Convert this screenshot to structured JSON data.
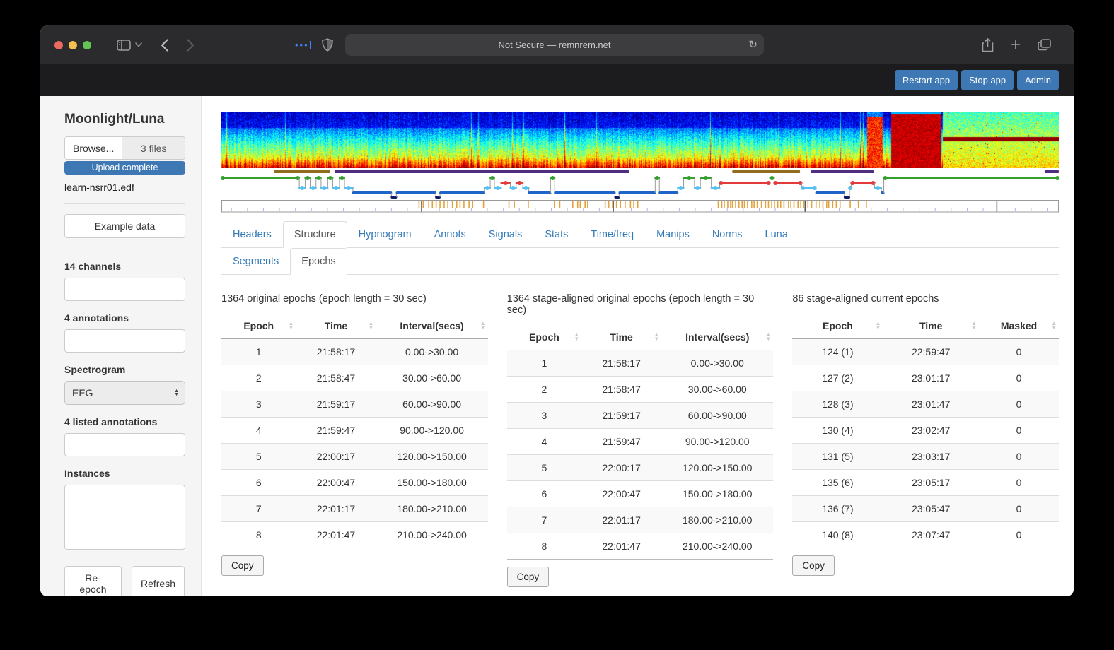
{
  "browser": {
    "url": "Not Secure — remnrem.net"
  },
  "app_header": {
    "buttons": [
      "Restart app",
      "Stop app",
      "Admin"
    ],
    "accent_color": "#3e78b4"
  },
  "sidebar": {
    "title": "Moonlight/Luna",
    "browse_button": "Browse...",
    "file_count": "3 files",
    "upload_status": "Upload complete",
    "file_name": "learn-nsrr01.edf",
    "example_data_button": "Example data",
    "channels_label": "14 channels",
    "channels_value": "",
    "annotations_label": "4 annotations",
    "annotations_value": "",
    "spectrogram_label": "Spectrogram",
    "spectrogram_channel": "EEG",
    "listed_annotations_label": "4 listed annotations",
    "listed_annotations_value": "",
    "instances_label": "Instances",
    "instances_value": "",
    "reepoch_button": "Re-epoch",
    "refresh_button": "Refresh"
  },
  "tabs": {
    "main": [
      "Headers",
      "Structure",
      "Hypnogram",
      "Annots",
      "Signals",
      "Stats",
      "Time/freq",
      "Manips",
      "Norms",
      "Luna"
    ],
    "active_main": "Structure",
    "sub": [
      "Segments",
      "Epochs"
    ],
    "active_sub": "Epochs"
  },
  "tables": [
    {
      "caption": "1364 original epochs (epoch length = 30 sec)",
      "columns": [
        "Epoch",
        "Time",
        "Interval(secs)"
      ],
      "col_widths": [
        "28%",
        "30%",
        "42%"
      ],
      "rows": [
        [
          "1",
          "21:58:17",
          "0.00->30.00"
        ],
        [
          "2",
          "21:58:47",
          "30.00->60.00"
        ],
        [
          "3",
          "21:59:17",
          "60.00->90.00"
        ],
        [
          "4",
          "21:59:47",
          "90.00->120.00"
        ],
        [
          "5",
          "22:00:17",
          "120.00->150.00"
        ],
        [
          "6",
          "22:00:47",
          "150.00->180.00"
        ],
        [
          "7",
          "22:01:17",
          "180.00->210.00"
        ],
        [
          "8",
          "22:01:47",
          "210.00->240.00"
        ]
      ],
      "copy_label": "Copy"
    },
    {
      "caption": "1364 stage-aligned original epochs (epoch length = 30 sec)",
      "columns": [
        "Epoch",
        "Time",
        "Interval(secs)"
      ],
      "col_widths": [
        "28%",
        "30%",
        "42%"
      ],
      "rows": [
        [
          "1",
          "21:58:17",
          "0.00->30.00"
        ],
        [
          "2",
          "21:58:47",
          "30.00->60.00"
        ],
        [
          "3",
          "21:59:17",
          "60.00->90.00"
        ],
        [
          "4",
          "21:59:47",
          "90.00->120.00"
        ],
        [
          "5",
          "22:00:17",
          "120.00->150.00"
        ],
        [
          "6",
          "22:00:47",
          "150.00->180.00"
        ],
        [
          "7",
          "22:01:17",
          "180.00->210.00"
        ],
        [
          "8",
          "22:01:47",
          "210.00->240.00"
        ]
      ],
      "copy_label": "Copy"
    },
    {
      "caption": "86 stage-aligned current epochs",
      "columns": [
        "Epoch",
        "Time",
        "Masked"
      ],
      "col_widths": [
        "34%",
        "36%",
        "30%"
      ],
      "rows": [
        [
          "124 (1)",
          "22:59:47",
          "0"
        ],
        [
          "127 (2)",
          "23:01:17",
          "0"
        ],
        [
          "128 (3)",
          "23:01:47",
          "0"
        ],
        [
          "130 (4)",
          "23:02:47",
          "0"
        ],
        [
          "131 (5)",
          "23:03:17",
          "0"
        ],
        [
          "135 (6)",
          "23:05:17",
          "0"
        ],
        [
          "136 (7)",
          "23:05:47",
          "0"
        ],
        [
          "140 (8)",
          "23:07:47",
          "0"
        ]
      ],
      "copy_label": "Copy"
    }
  ],
  "timeline": {
    "annotation_bars": [
      {
        "start": 0.063,
        "end": 0.13,
        "color": "#8f6c1e"
      },
      {
        "start": 0.135,
        "end": 0.487,
        "color": "#4f2d7f"
      },
      {
        "start": 0.61,
        "end": 0.691,
        "color": "#8f6c1e"
      },
      {
        "start": 0.704,
        "end": 0.779,
        "color": "#4f2d7f"
      },
      {
        "start": 0.983,
        "end": 1.0,
        "color": "#4f2d7f"
      }
    ],
    "hypnogram": {
      "stage_colors": {
        "W": "#33a02c",
        "R": "#e33b3b",
        "N1": "#56c1f0",
        "N2": "#1f64c8",
        "N3": "#101c66"
      },
      "segments": [
        [
          "W",
          0.0,
          0.093
        ],
        [
          "N1",
          0.093,
          0.1
        ],
        [
          "W",
          0.1,
          0.106
        ],
        [
          "N1",
          0.106,
          0.113
        ],
        [
          "W",
          0.113,
          0.119
        ],
        [
          "N1",
          0.119,
          0.127
        ],
        [
          "W",
          0.127,
          0.133
        ],
        [
          "N1",
          0.133,
          0.141
        ],
        [
          "W",
          0.141,
          0.147
        ],
        [
          "N1",
          0.147,
          0.157
        ],
        [
          "N2",
          0.157,
          0.203
        ],
        [
          "N3",
          0.203,
          0.209
        ],
        [
          "N2",
          0.209,
          0.256
        ],
        [
          "N3",
          0.256,
          0.261
        ],
        [
          "N2",
          0.261,
          0.314
        ],
        [
          "N1",
          0.314,
          0.321
        ],
        [
          "W",
          0.321,
          0.326
        ],
        [
          "N1",
          0.326,
          0.334
        ],
        [
          "R",
          0.334,
          0.345
        ],
        [
          "N1",
          0.345,
          0.352
        ],
        [
          "R",
          0.352,
          0.36
        ],
        [
          "N1",
          0.36,
          0.367
        ],
        [
          "N2",
          0.367,
          0.393
        ],
        [
          "W",
          0.393,
          0.398
        ],
        [
          "N2",
          0.398,
          0.47
        ],
        [
          "N3",
          0.47,
          0.475
        ],
        [
          "N2",
          0.475,
          0.518
        ],
        [
          "W",
          0.518,
          0.523
        ],
        [
          "N2",
          0.523,
          0.545
        ],
        [
          "N1",
          0.545,
          0.552
        ],
        [
          "W",
          0.552,
          0.565
        ],
        [
          "N1",
          0.565,
          0.572
        ],
        [
          "W",
          0.572,
          0.585
        ],
        [
          "N1",
          0.585,
          0.595
        ],
        [
          "R",
          0.595,
          0.655
        ],
        [
          "W",
          0.655,
          0.66
        ],
        [
          "R",
          0.66,
          0.693
        ],
        [
          "N1",
          0.693,
          0.71
        ],
        [
          "N2",
          0.71,
          0.744
        ],
        [
          "N3",
          0.744,
          0.75
        ],
        [
          "N1",
          0.75,
          0.752
        ],
        [
          "R",
          0.752,
          0.78
        ],
        [
          "N1",
          0.78,
          0.788
        ],
        [
          "N2",
          0.788,
          0.791
        ],
        [
          "W",
          0.791,
          1.0
        ]
      ]
    },
    "artifact_ticks": {
      "color": "#e2a23c",
      "clusters": [
        [
          0.237,
          0.3,
          14
        ],
        [
          0.312,
          0.314,
          1
        ],
        [
          0.344,
          0.35,
          2
        ],
        [
          0.365,
          0.368,
          1
        ],
        [
          0.398,
          0.404,
          2
        ],
        [
          0.42,
          0.438,
          5
        ],
        [
          0.459,
          0.476,
          5
        ],
        [
          0.483,
          0.497,
          4
        ],
        [
          0.593,
          0.64,
          14
        ],
        [
          0.645,
          0.704,
          16
        ],
        [
          0.71,
          0.738,
          8
        ],
        [
          0.75,
          0.77,
          3
        ]
      ]
    },
    "ruler": {
      "minor_step": 0.0191,
      "minor_color": "#a8b8e8",
      "major_positions": [
        0.239,
        0.468,
        0.697,
        0.926
      ],
      "major_color": "#555555"
    }
  },
  "icons": {
    "reload": "↻",
    "back_chevron": "‹",
    "forward_chevron": "›",
    "chevron_down": "ˇ",
    "plus": "+",
    "sort_up": "▲",
    "sort_down": "▼"
  },
  "colors": {
    "link_blue": "#337ab7",
    "sidebar_bg": "#f5f5f5",
    "titlebar_bg": "#2b2b2d",
    "appbar_bg": "#1c1c1e"
  }
}
